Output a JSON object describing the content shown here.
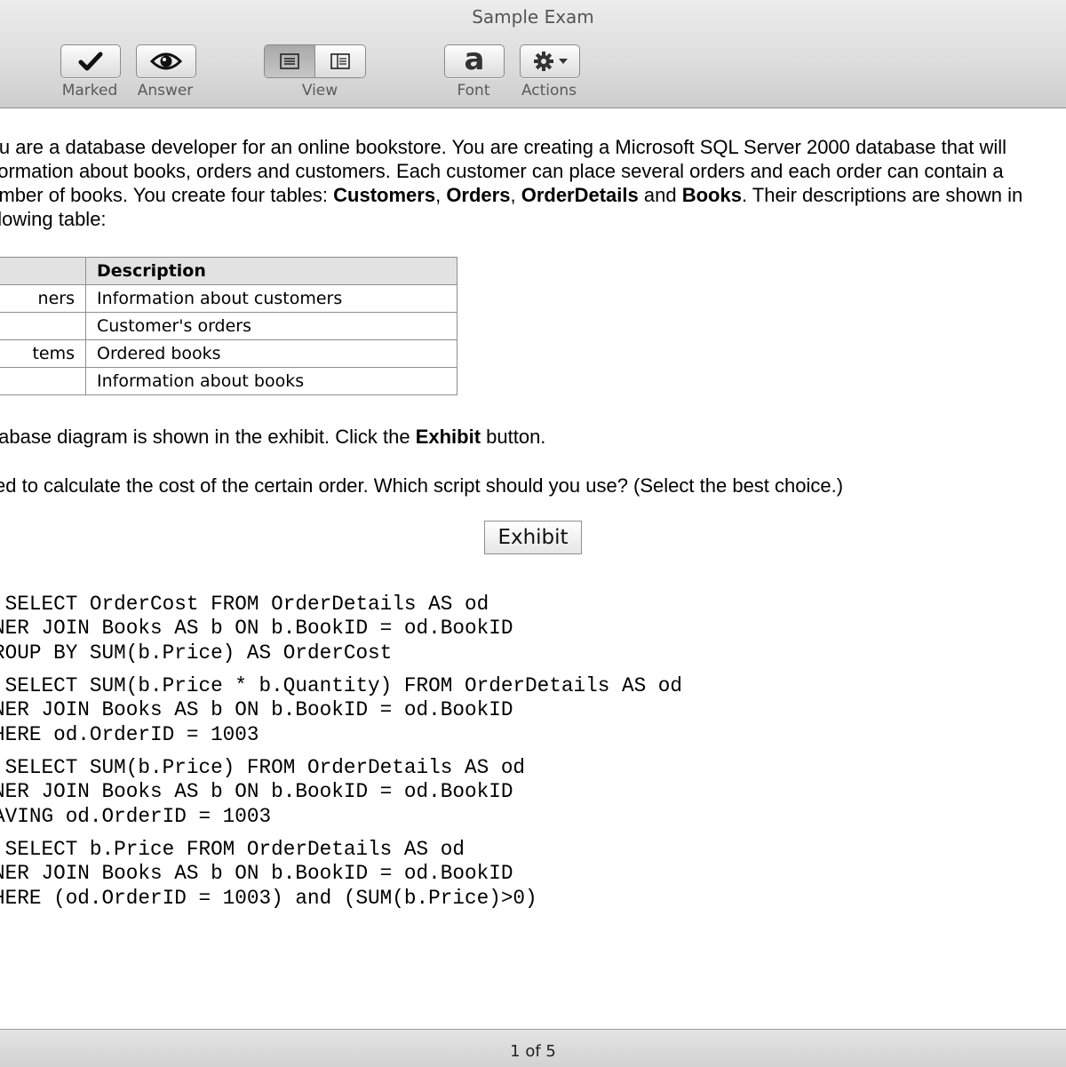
{
  "window": {
    "title": "Sample Exam"
  },
  "toolbar": {
    "marked_label": "Marked",
    "answer_label": "Answer",
    "view_label": "View",
    "font_label": "Font",
    "font_glyph": "a",
    "actions_label": "Actions"
  },
  "question": {
    "intro": [
      [
        {
          "t": "You are a database developer for an online bookstore. You are creating a Microsoft SQL Server 2000 database that will"
        }
      ],
      [
        {
          "t": "information about books, orders and customers. Each customer can place several orders and each order can contain a"
        }
      ],
      [
        {
          "t": "number of books. You create four tables: "
        },
        {
          "t": "Customers",
          "b": true
        },
        {
          "t": ", "
        },
        {
          "t": "Orders",
          "b": true
        },
        {
          "t": ", "
        },
        {
          "t": "OrderDetails",
          "b": true
        },
        {
          "t": " and "
        },
        {
          "t": "Books",
          "b": true
        },
        {
          "t": ". Their descriptions are shown in"
        }
      ],
      [
        {
          "t": "following table:"
        }
      ]
    ],
    "table": {
      "headers": [
        "",
        "Description"
      ],
      "rows": [
        [
          "ners",
          "Information about customers"
        ],
        [
          "",
          "Customer's orders"
        ],
        [
          "tems",
          "Ordered books"
        ],
        [
          "",
          "Information about books"
        ]
      ]
    },
    "diagram_note_prefix": "tabase diagram is shown in the exhibit. Click the ",
    "diagram_note_bold": "Exhibit",
    "diagram_note_suffix": " button.",
    "prompt": "ed to calculate the cost of the certain order. Which script should you use? (Select the best choice.)",
    "exhibit_label": "Exhibit",
    "choices": [
      " SELECT OrderCost FROM OrderDetails AS od\nNER JOIN Books AS b ON b.BookID = od.BookID\nROUP BY SUM(b.Price) AS OrderCost",
      " SELECT SUM(b.Price * b.Quantity) FROM OrderDetails AS od\nNER JOIN Books AS b ON b.BookID = od.BookID\nHERE od.OrderID = 1003",
      " SELECT SUM(b.Price) FROM OrderDetails AS od\nNER JOIN Books AS b ON b.BookID = od.BookID\nAVING od.OrderID = 1003",
      " SELECT b.Price FROM OrderDetails AS od\nNER JOIN Books AS b ON b.BookID = od.BookID\nHERE (od.OrderID = 1003) and (SUM(b.Price)>0)"
    ]
  },
  "status": {
    "page_indicator": "1 of 5"
  }
}
